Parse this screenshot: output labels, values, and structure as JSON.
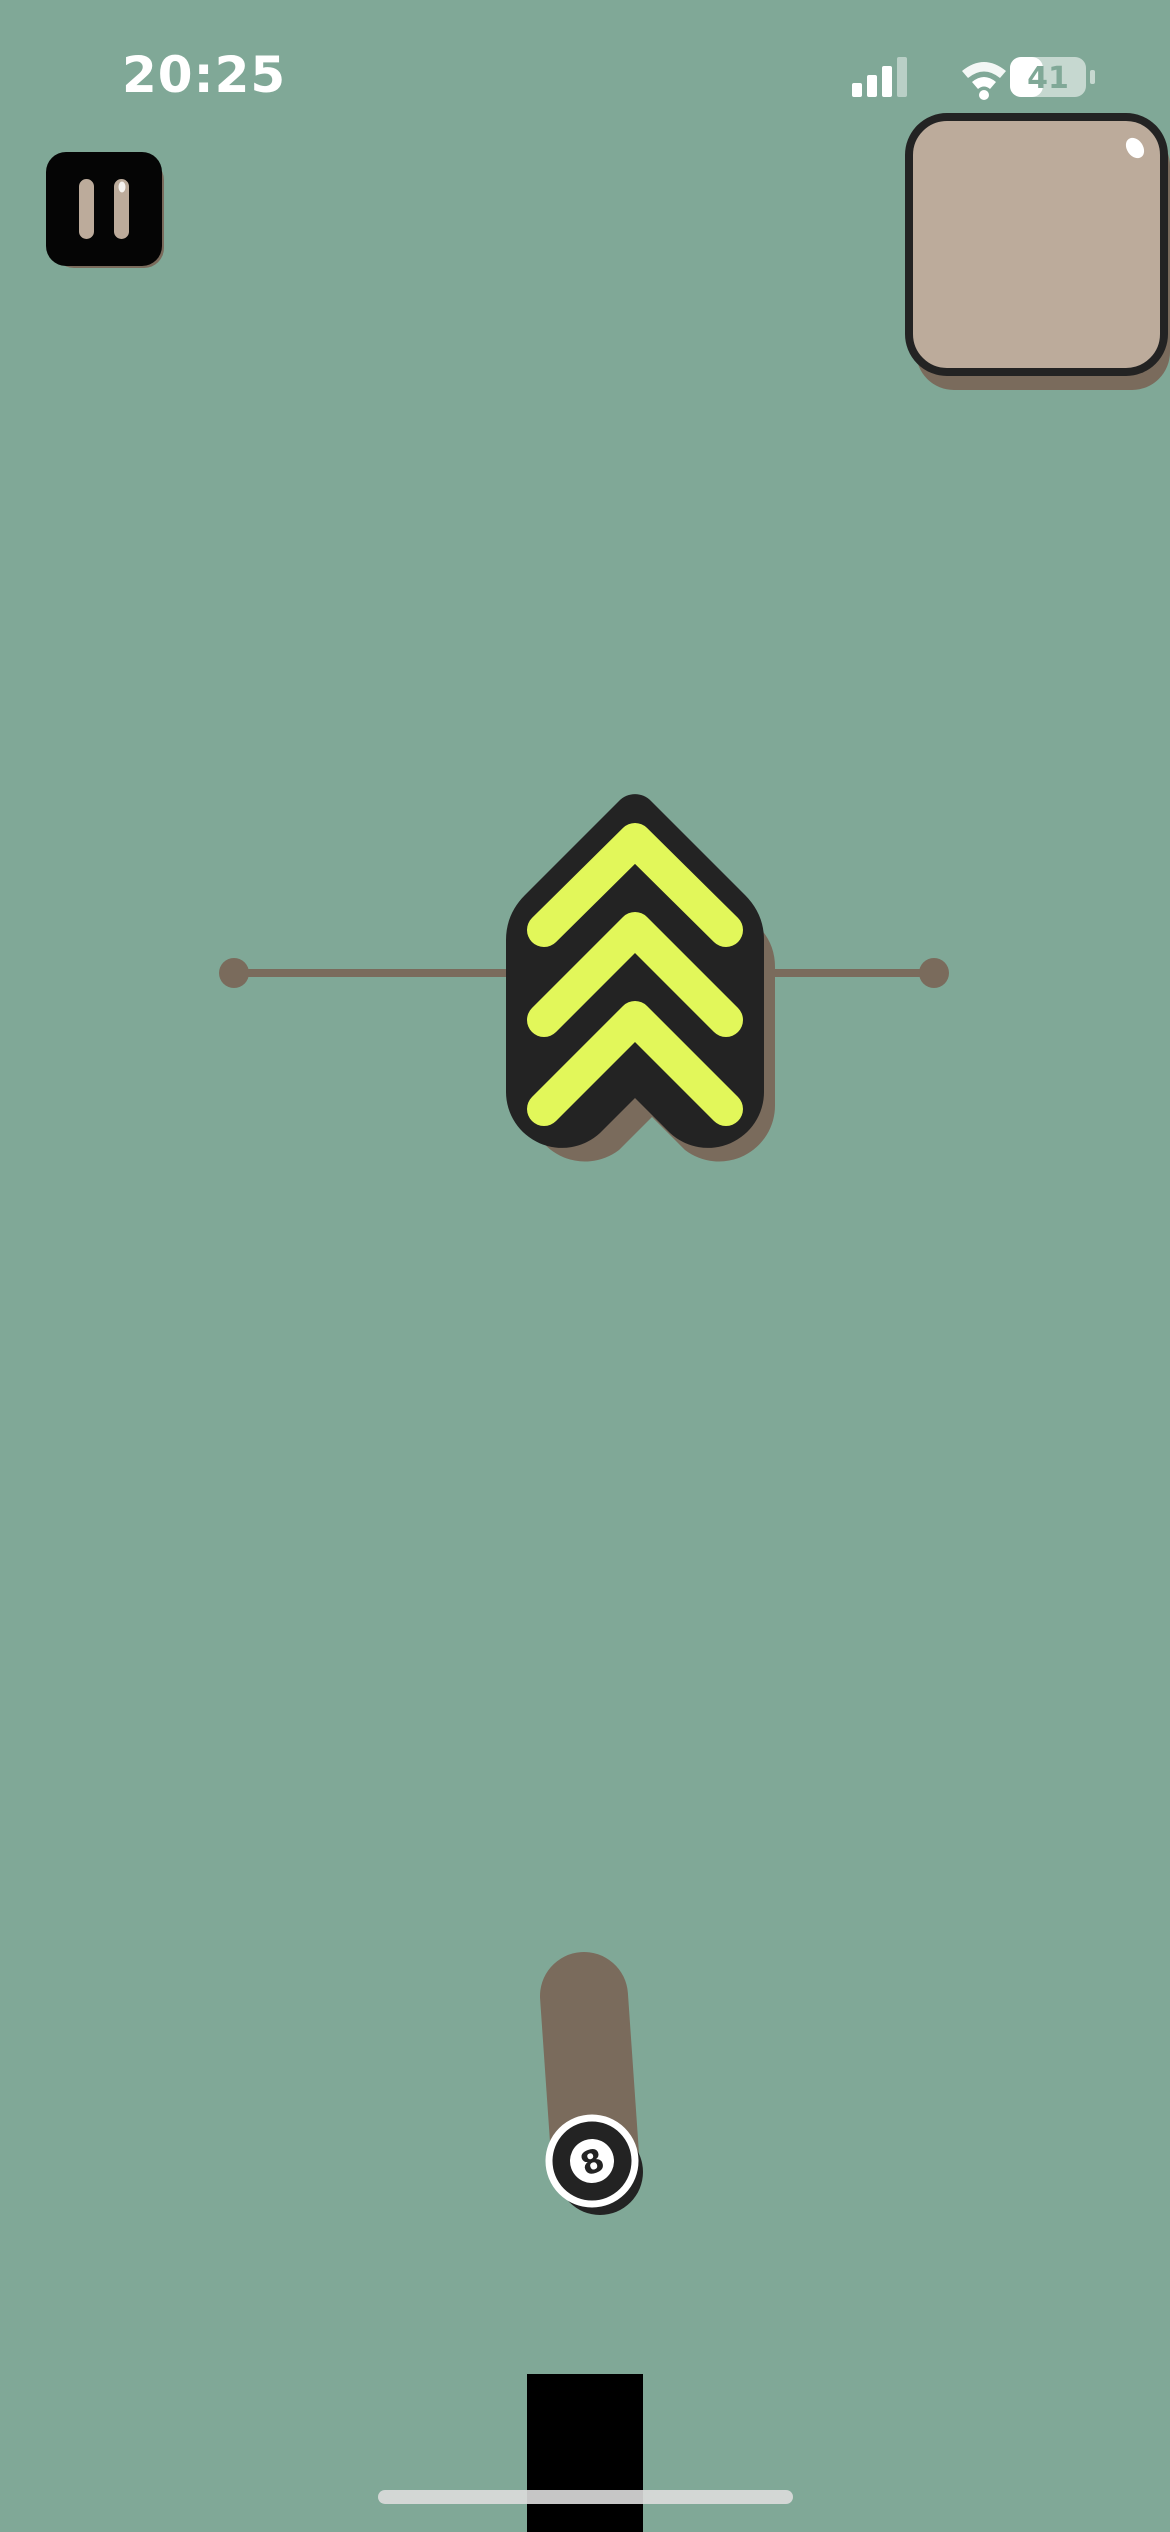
{
  "status_bar": {
    "time": "20:25",
    "battery_level": "41",
    "signal_icon": "cellular-signal-icon",
    "wifi_icon": "wifi-icon",
    "battery_icon": "battery-icon"
  },
  "hud": {
    "pause_icon": "pause-icon",
    "bonus_card_icon": "rounded-square-card-icon"
  },
  "game": {
    "booster_icon": "triple-chevron-up-icon",
    "ball_label": "8",
    "ball_icon": "eight-ball-icon"
  },
  "colors": {
    "background": "#80a897",
    "track": "#7a6b5c",
    "card": "#bcab9b",
    "chevron": "#e2f75a",
    "dark": "#232323"
  }
}
